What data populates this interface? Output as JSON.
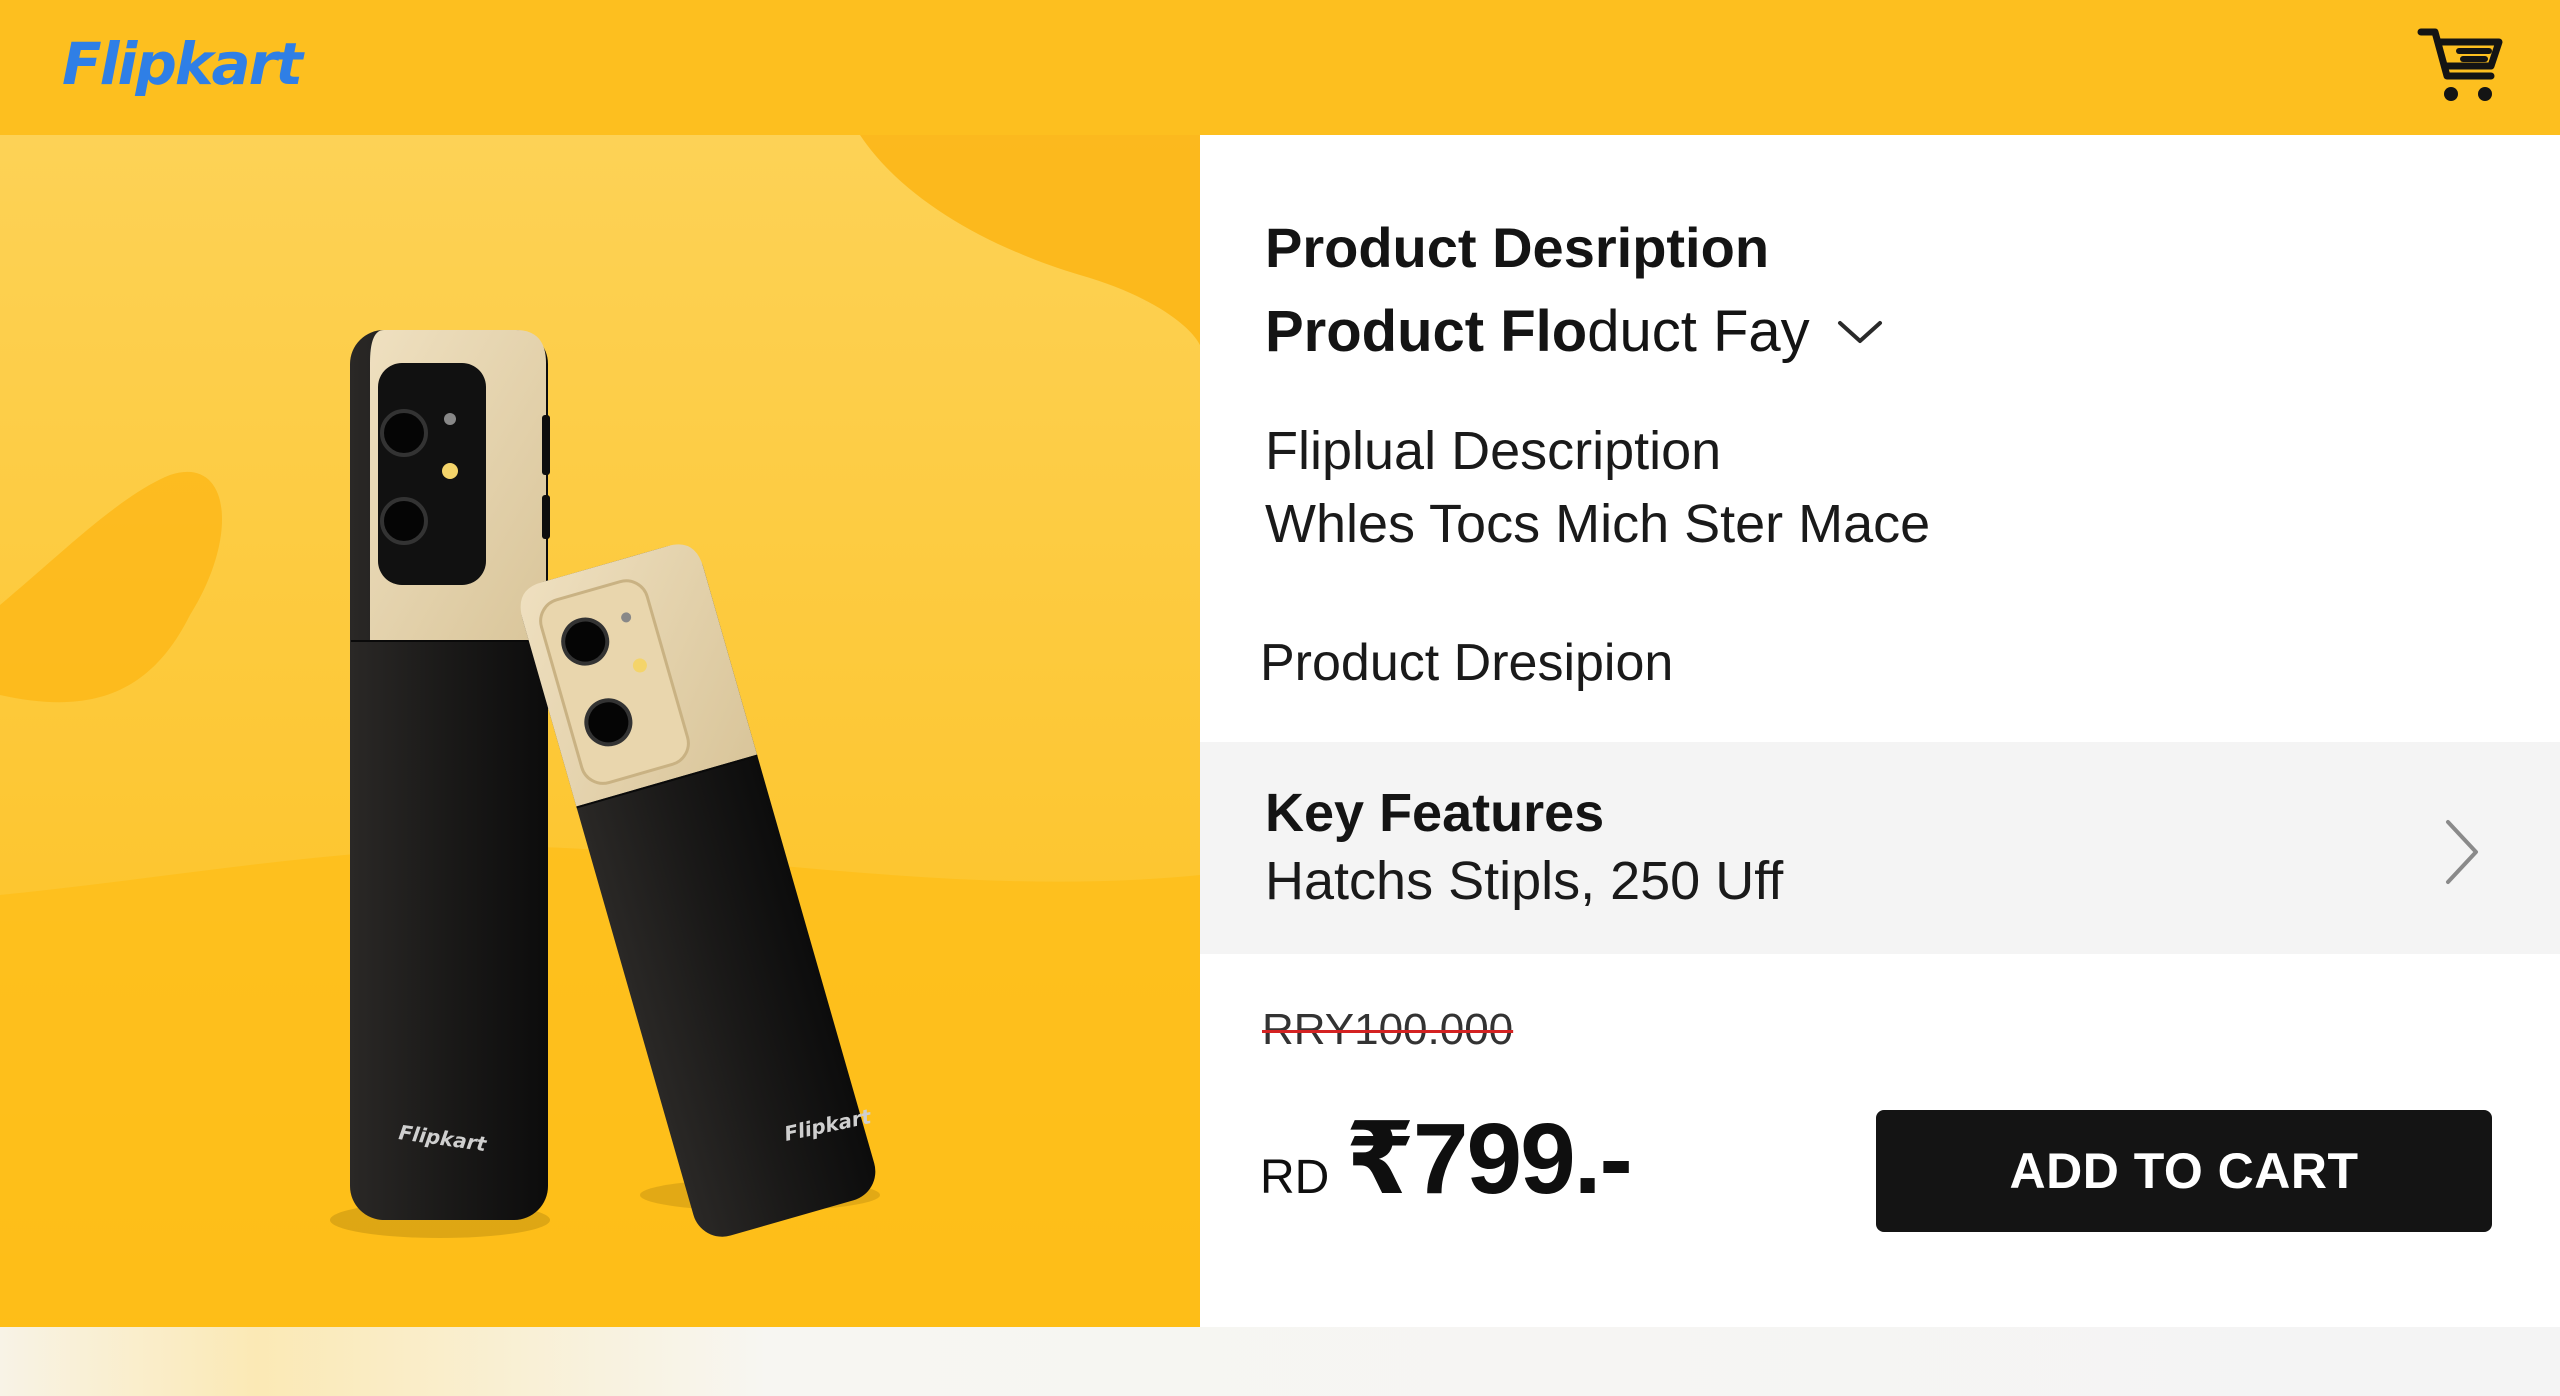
{
  "header": {
    "logo": "Flipkart",
    "cart_icon": "cart-icon"
  },
  "hero": {
    "phone_brand_left": "Flipkart",
    "phone_brand_right": "Flipkart"
  },
  "product": {
    "title": "Product Desription",
    "variant_bold": "Product Flo",
    "variant_rest": "duct Fay",
    "variant_icon": "chevron-down-icon",
    "description_line1": "Fliplual Description",
    "description_line2": "Whles Tocs Mich Ster Mace",
    "description_line3": "Product Dresipion"
  },
  "features": {
    "title": "Key Features",
    "subtitle": "Hatchs Stipls, 250 Uff",
    "icon": "chevron-right-icon"
  },
  "pricing": {
    "original_price": "RRY100.000",
    "currency_label": "RD",
    "price": "₹799.-",
    "add_to_cart": "ADD TO CART"
  },
  "colors": {
    "brand_yellow": "#fdbf1f",
    "logo_blue": "#2f7fe6",
    "button_black": "#141414",
    "strike_red": "#d42222"
  }
}
